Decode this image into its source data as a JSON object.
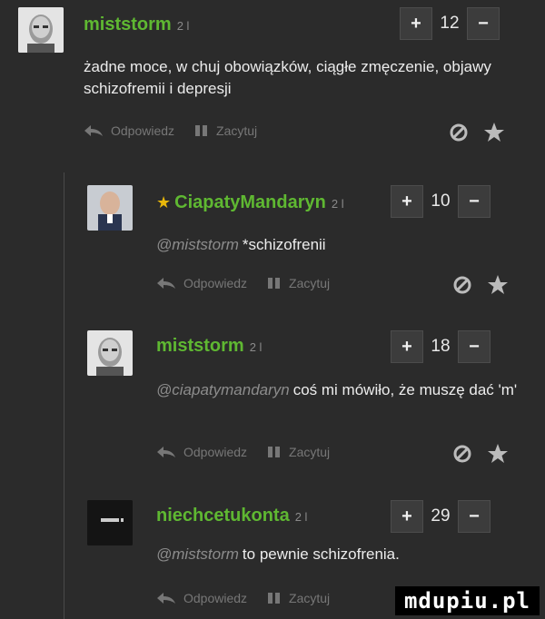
{
  "comments": [
    {
      "username": "miststorm",
      "level": "2 l",
      "score": "12",
      "mention": "",
      "text": "żadne moce, w chuj obowiązków, ciągłe zmęczenie, objawy schizofremii i depresji",
      "reply_label": "Odpowiedz",
      "quote_label": "Zacytuj",
      "starred": false
    },
    {
      "username": "CiapatyMandaryn",
      "level": "2 l",
      "score": "10",
      "mention": "@miststorm",
      "text": "*schizofrenii",
      "reply_label": "Odpowiedz",
      "quote_label": "Zacytuj",
      "starred": true
    },
    {
      "username": "miststorm",
      "level": "2 l",
      "score": "18",
      "mention": "@ciapatymandaryn",
      "text": "coś mi mówiło, że muszę dać 'm'",
      "reply_label": "Odpowiedz",
      "quote_label": "Zacytuj",
      "starred": false
    },
    {
      "username": "niechcetukonta",
      "level": "2 l",
      "score": "29",
      "mention": "@miststorm",
      "text": "to pewnie schizofrenia.",
      "reply_label": "Odpowiedz",
      "quote_label": "Zacytuj",
      "starred": false
    }
  ],
  "vote": {
    "plus": "+",
    "minus": "−"
  },
  "watermark": "mdupiu.pl",
  "colors": {
    "username": "#5fb832",
    "star": "#e8b70a",
    "background": "#2b2b2b"
  },
  "icons": [
    "reply-arrow-icon",
    "quote-icon",
    "block-icon",
    "star-icon"
  ]
}
